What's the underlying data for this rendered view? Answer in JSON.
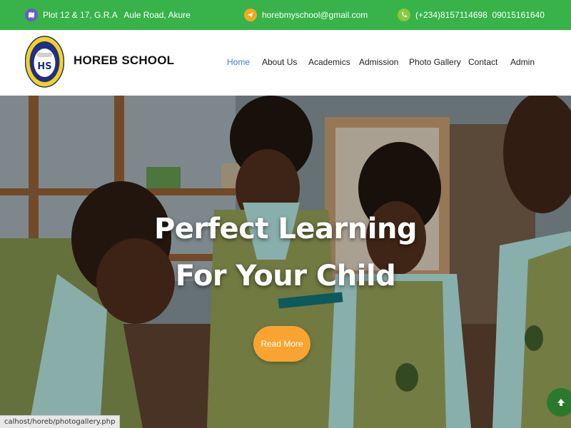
{
  "topbar": {
    "address": "Plot 12 & 17, G.R.A   Aule Road, Akure",
    "email": "horebmyschool@gmail.com",
    "phone": "(+234)8157114698  09015161640"
  },
  "header": {
    "brand": "HOREB SCHOOL",
    "logo": {
      "ring_text": "HOREB NUR/PRY SCHOOL",
      "initials": "HS"
    },
    "nav": [
      {
        "label": "Home",
        "active": true
      },
      {
        "label": "About Us"
      },
      {
        "label": "Academics"
      },
      {
        "label": "Admission"
      },
      {
        "label": "Photo Gallery"
      },
      {
        "label": "Contact"
      },
      {
        "label": "Admin"
      }
    ]
  },
  "hero": {
    "title_line1": "Perfect Learning",
    "title_line2": "For Your Child",
    "cta_label": "Read More"
  },
  "status_url": "calhost/horeb/photogallery.php",
  "colors": {
    "topbar_green": "#37b349",
    "nav_active": "#3a7ec8",
    "cta_orange": "#f9a431",
    "float_green": "#2a7a2e"
  }
}
